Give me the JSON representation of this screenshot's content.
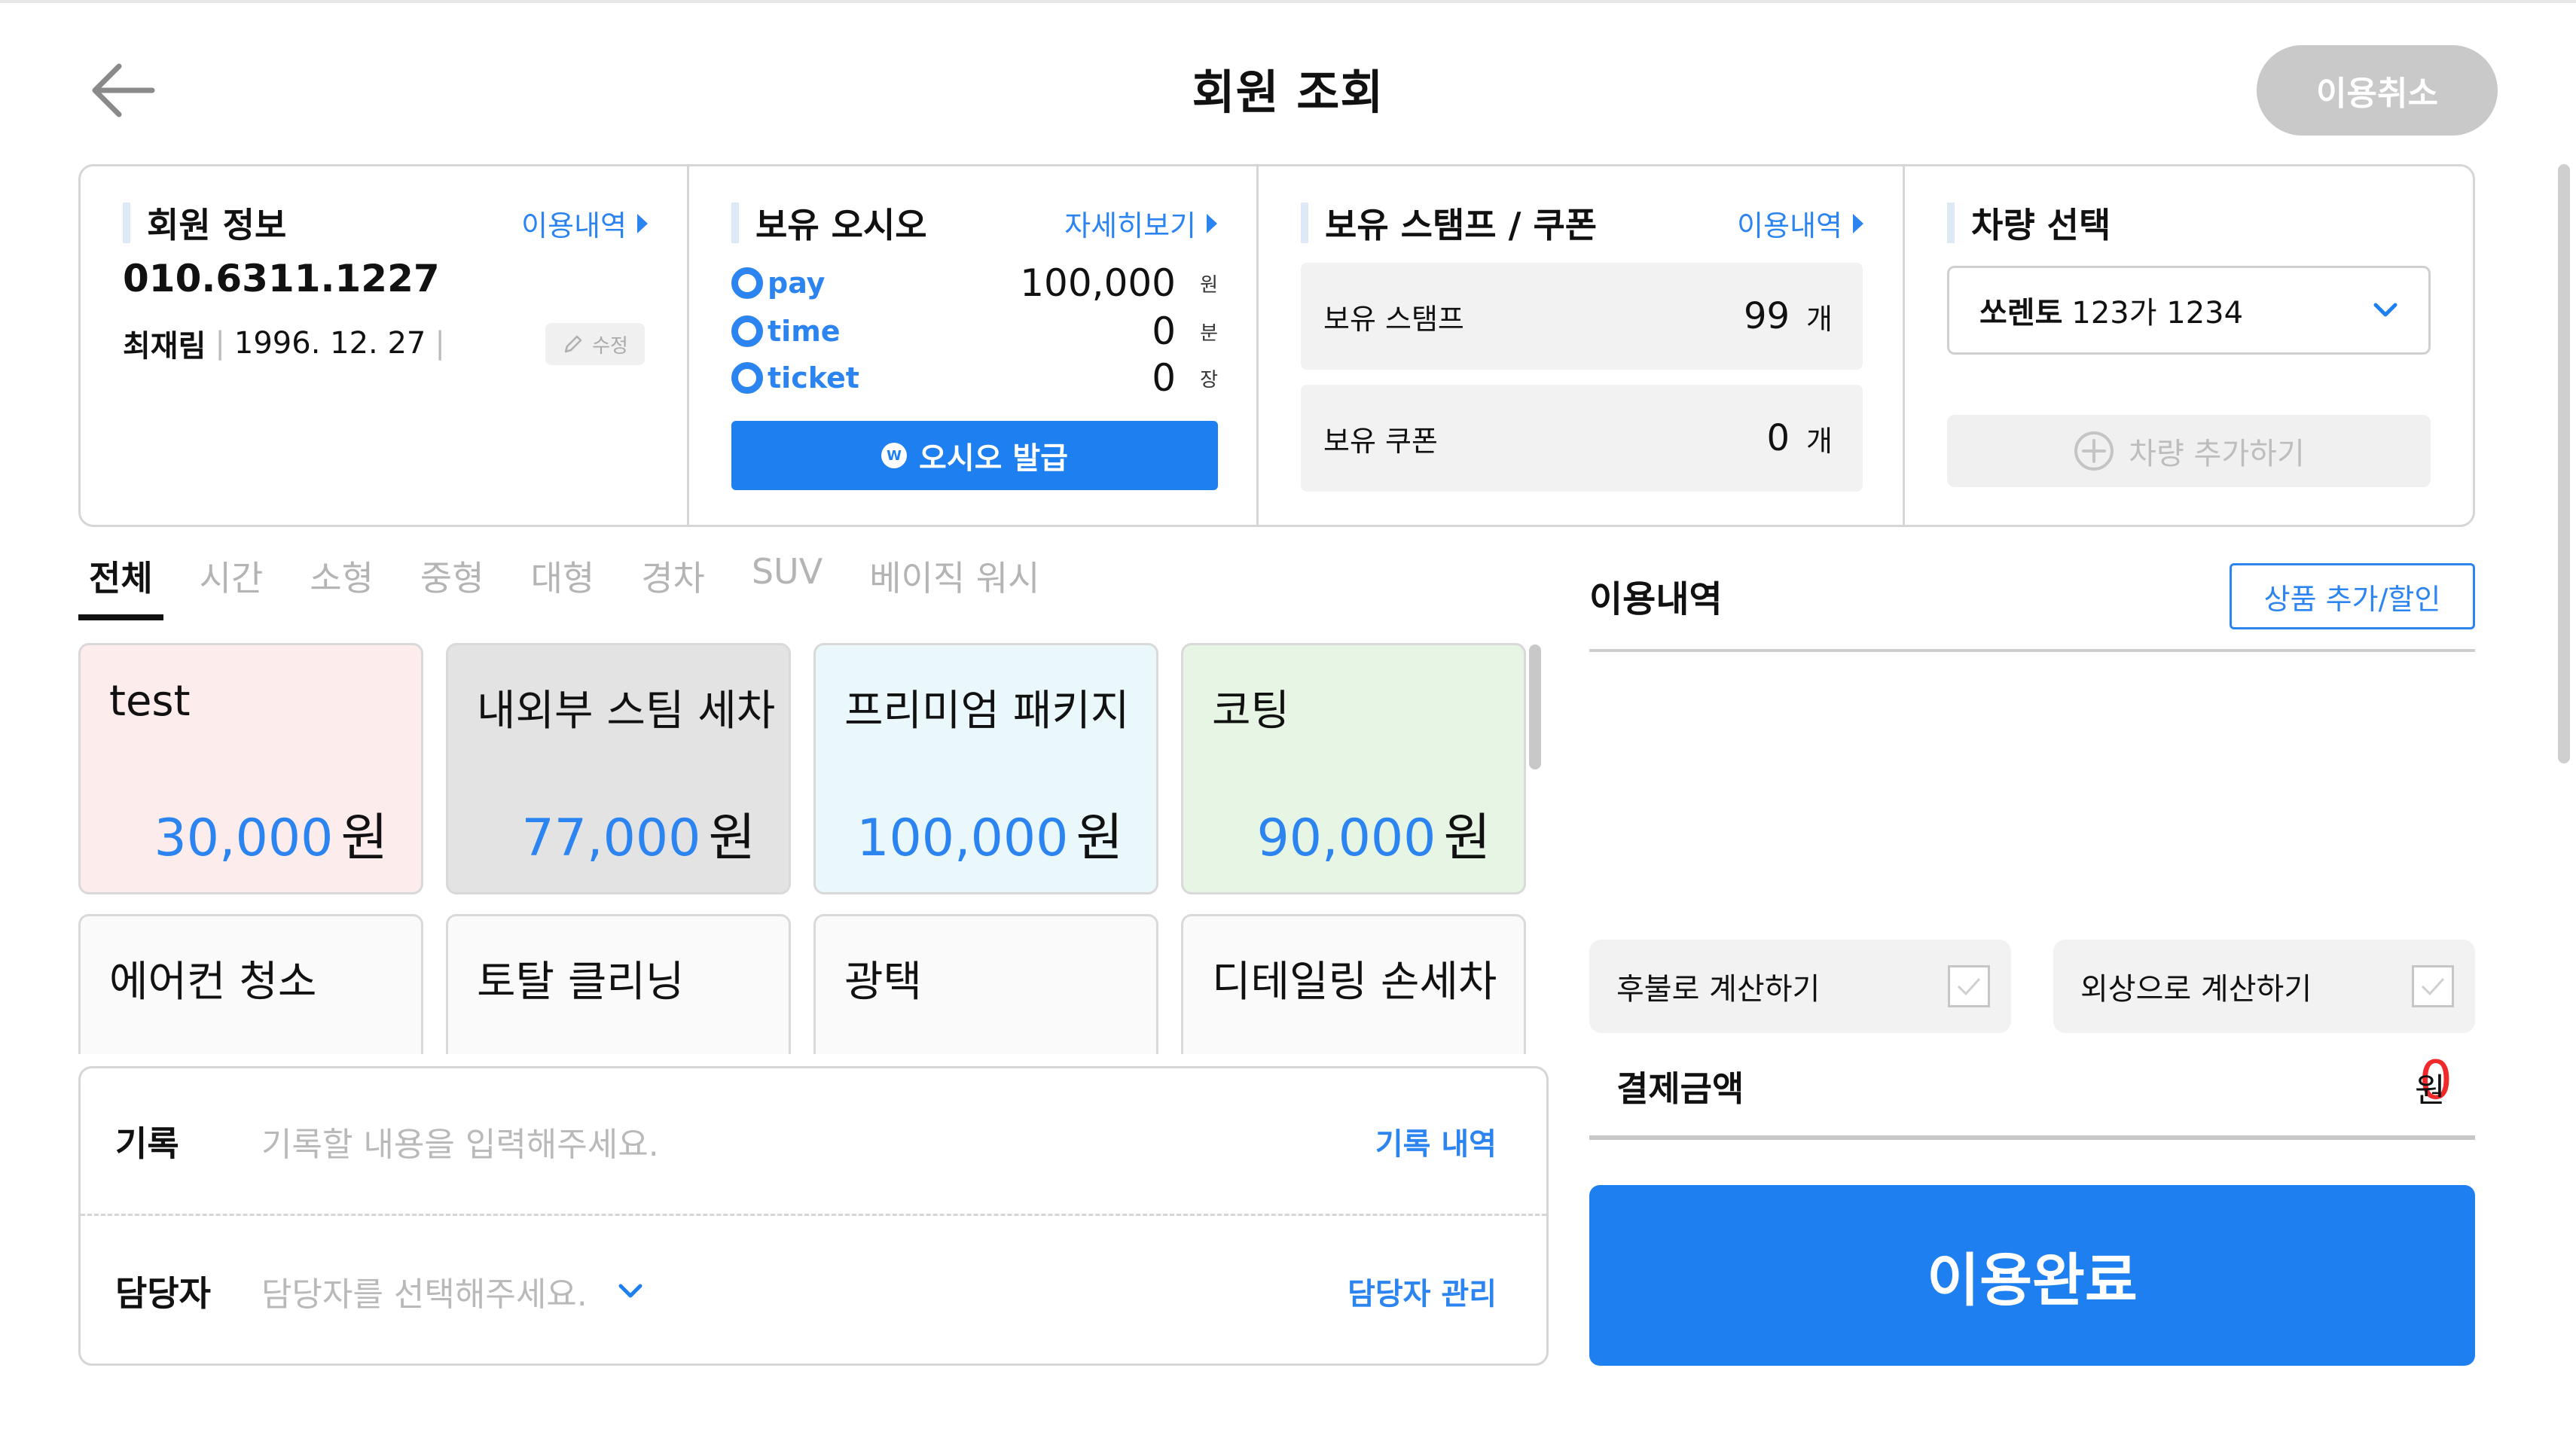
{
  "header": {
    "title": "회원 조회",
    "cancel_label": "이용취소"
  },
  "member": {
    "title": "회원 정보",
    "link": "이용내역",
    "phone": "010.6311.1227",
    "name": "최재림",
    "birth": "1996. 12. 27",
    "edit_label": "수정"
  },
  "osio": {
    "title": "보유 오시오",
    "link": "자세히보기",
    "rows": [
      {
        "label": "pay",
        "value": "100,000",
        "unit": "원"
      },
      {
        "label": "time",
        "value": "0",
        "unit": "분"
      },
      {
        "label": "ticket",
        "value": "0",
        "unit": "장"
      }
    ],
    "issue_label": "오시오 발급",
    "issue_icon": "W"
  },
  "stamp": {
    "title": "보유 스탬프 / 쿠폰",
    "link": "이용내역",
    "stamp_label": "보유 스탬프",
    "stamp_value": "99",
    "stamp_unit": "개",
    "coupon_label": "보유 쿠폰",
    "coupon_value": "0",
    "coupon_unit": "개"
  },
  "car": {
    "title": "차량 선택",
    "selected_model": "쏘렌토",
    "selected_plate": "123가 1234",
    "add_label": "차량 추가하기"
  },
  "tabs": [
    "전체",
    "시간",
    "소형",
    "중형",
    "대형",
    "경차",
    "SUV",
    "베이직 워시"
  ],
  "products": [
    {
      "name": "test",
      "price": "30,000",
      "unit": "원",
      "bg": "#fdecec"
    },
    {
      "name": "내외부 스팀 세차",
      "price": "77,000",
      "unit": "원",
      "bg": "#e3e3e3"
    },
    {
      "name": "프리미엄 패키지",
      "price": "100,000",
      "unit": "원",
      "bg": "#eaf8fb"
    },
    {
      "name": "코팅",
      "price": "90,000",
      "unit": "원",
      "bg": "#e6f5e4"
    },
    {
      "name": "에어컨 청소",
      "price": "",
      "unit": "",
      "bg": "#fafafa"
    },
    {
      "name": "토탈 클리닝",
      "price": "",
      "unit": "",
      "bg": "#fafafa"
    },
    {
      "name": "광택",
      "price": "",
      "unit": "",
      "bg": "#fafafa"
    },
    {
      "name": "디테일링 손세차",
      "price": "",
      "unit": "",
      "bg": "#fafafa"
    }
  ],
  "record": {
    "label": "기록",
    "placeholder": "기록할 내용을 입력해주세요.",
    "link": "기록 내역",
    "staff_label": "담당자",
    "staff_placeholder": "담당자를 선택해주세요.",
    "staff_link": "담당자 관리"
  },
  "usage": {
    "title": "이용내역",
    "add_label": "상품 추가/할인",
    "deferred_label": "후불로 계산하기",
    "credit_label": "외상으로 계산하기",
    "pay_label": "결제금액",
    "pay_amount": "0",
    "pay_unit": "원",
    "complete_label": "이용완료"
  },
  "colors": {
    "accent": "#1e7ff0",
    "link": "#2b84f0",
    "amount": "#f02a2a"
  }
}
